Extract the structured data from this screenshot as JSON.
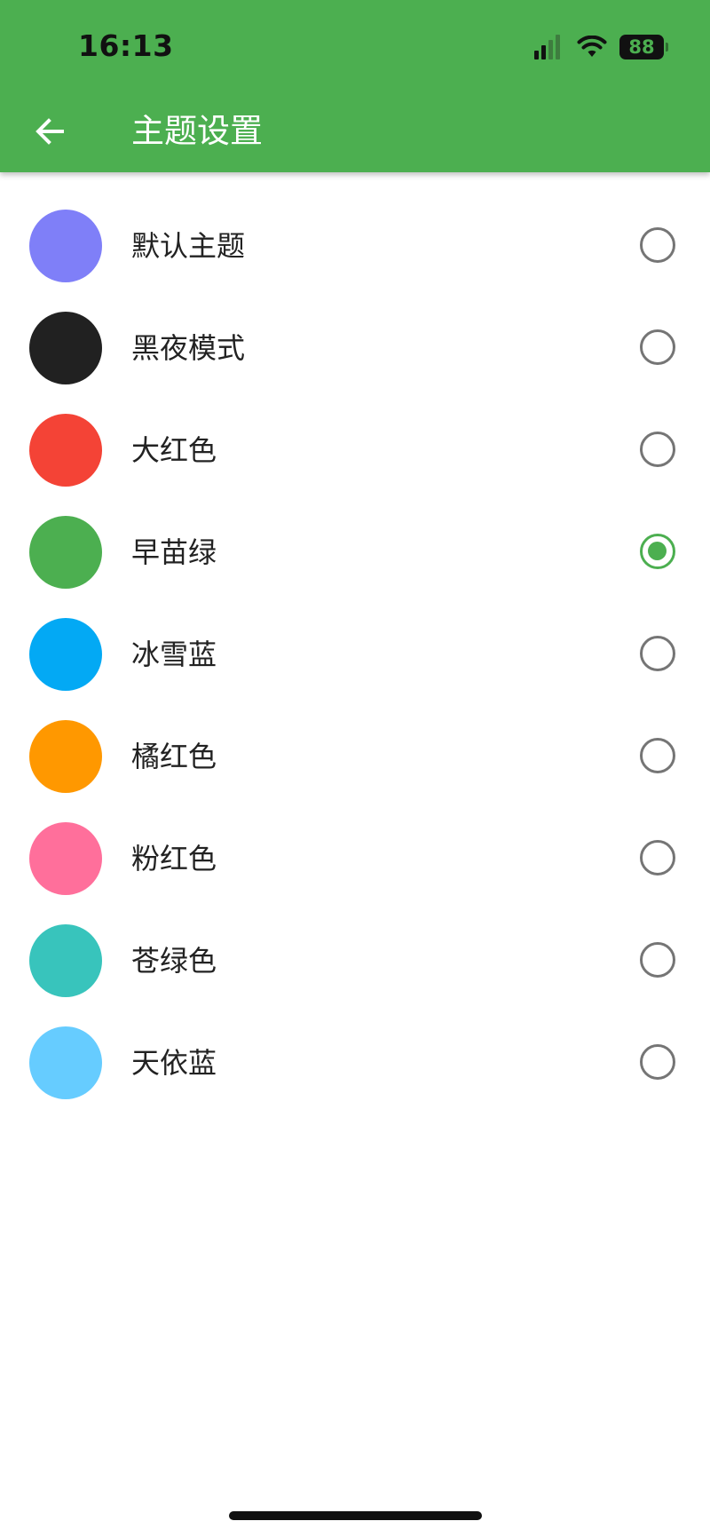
{
  "status_bar": {
    "time": "16:13",
    "battery": "88",
    "icons": [
      "signal-icon",
      "wifi-icon",
      "battery-icon"
    ]
  },
  "header": {
    "title": "主题设置",
    "back_icon": "arrow-left-icon",
    "background_color": "#4caf50"
  },
  "themes": [
    {
      "label": "默认主题",
      "color": "#7f7ff8",
      "selected": false
    },
    {
      "label": "黑夜模式",
      "color": "#212121",
      "selected": false
    },
    {
      "label": "大红色",
      "color": "#f44336",
      "selected": false
    },
    {
      "label": "早苗绿",
      "color": "#4caf50",
      "selected": true
    },
    {
      "label": "冰雪蓝",
      "color": "#03a9f4",
      "selected": false
    },
    {
      "label": "橘红色",
      "color": "#ff9800",
      "selected": false
    },
    {
      "label": "粉红色",
      "color": "#ff6f9b",
      "selected": false
    },
    {
      "label": "苍绿色",
      "color": "#38c4bc",
      "selected": false
    },
    {
      "label": "天依蓝",
      "color": "#66ccff",
      "selected": false
    }
  ],
  "colors": {
    "accent": "#4caf50",
    "radio_unselected": "#757575"
  }
}
